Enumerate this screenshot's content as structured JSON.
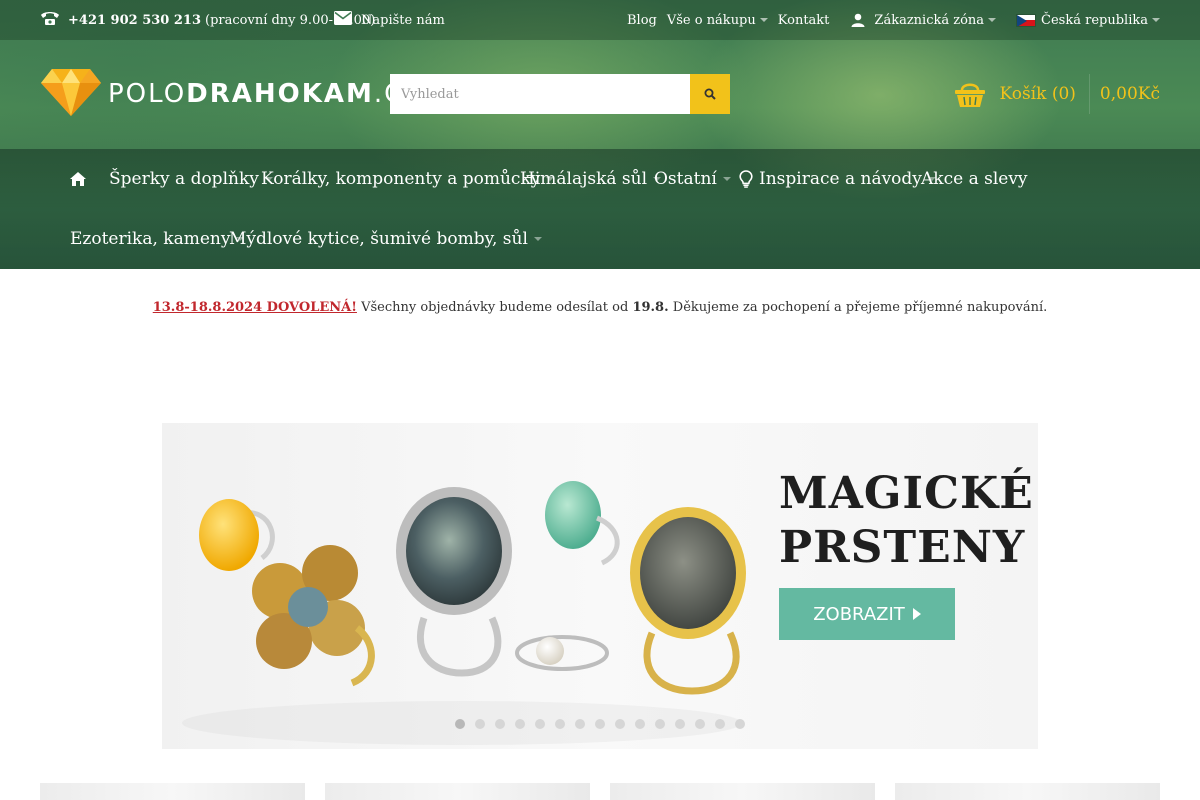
{
  "topbar": {
    "phone_number": "+421 902 530 213",
    "phone_hours": "(pracovní dny 9.00-16.00)",
    "mail_label": "Napište nám",
    "links": [
      "Blog",
      "Vše o nákupu",
      "Kontakt"
    ],
    "customer_zone": "Zákaznická zóna",
    "country": "Česká republika"
  },
  "logo": {
    "part1": "POLO",
    "part2": "DRAHOKAM",
    "part3": ".CZ"
  },
  "search": {
    "placeholder": "Vyhledat"
  },
  "cart": {
    "label": "Košík (0)",
    "total": "0,00Kč"
  },
  "nav": {
    "items": [
      "Šperky a doplňky",
      "Korálky, komponenty a pomůcky",
      "Himálajská sůl",
      "Ostatní",
      "Inspirace a návody",
      "Akce a slevy",
      "Ezoterika, kameny",
      "Mýdlové kytice, šumivé bomby, sůl"
    ]
  },
  "notice": {
    "highlight": "13.8-18.8.2024 DOVOLENÁ!",
    "text1": " Všechny objednávky budeme odesílat od ",
    "date": "19.8.",
    "text2": " Děkujeme za pochopení a přejeme příjemné nakupování."
  },
  "banner": {
    "title_line1": "MAGICKÉ",
    "title_line2": "PRSTENY",
    "button_label": "ZOBRAZIT",
    "slide_count": 15,
    "active_slide": 1
  },
  "colors": {
    "accent_yellow": "#f2c21a",
    "banner_button": "#64b9a1",
    "notice_red": "#c1272d",
    "header_green": "#4b8a55"
  }
}
